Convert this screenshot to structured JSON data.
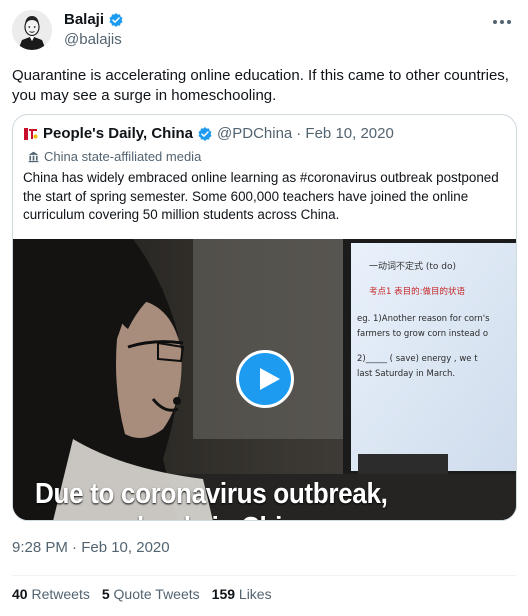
{
  "author": {
    "name": "Balaji",
    "handle": "@balajis"
  },
  "tweet": {
    "text": "Quarantine is accelerating online education. If this came to other countries, you may see a surge in homeschooling.",
    "timestamp": "9:28 PM · Feb 10, 2020"
  },
  "quoted": {
    "name": "People's Daily, China",
    "handle": "@PDChina",
    "date": "· Feb 10, 2020",
    "affiliation": "China state-affiliated media",
    "text": "China has widely embraced online learning as #coronavirus outbreak postponed the start of spring semester. Some 600,000 teachers have joined the online curriculum covering 50 million students across China.",
    "video_caption_line1": "Due to coronavirus outbreak,",
    "video_caption_line2": "many schools in China",
    "monitor_lines": [
      "一动词不定式 (to do)",
      "考点1 表目的:做目的状语",
      "eg. 1)Another reason for corn's",
      "farmers to grow corn instead o",
      "2)_____ ( save) energy , we t",
      "last Saturday in March."
    ]
  },
  "stats": {
    "retweets_count": "40",
    "retweets_label": "Retweets",
    "quotes_count": "5",
    "quotes_label": "Quote Tweets",
    "likes_count": "159",
    "likes_label": "Likes"
  },
  "colors": {
    "accent": "#1d9bf0",
    "text": "#0f1419",
    "secondary": "#536471",
    "border": "#cfd9de"
  },
  "icons": [
    "verified-badge-icon",
    "more-icon",
    "people-daily-logo-icon",
    "building-icon",
    "play-icon"
  ]
}
